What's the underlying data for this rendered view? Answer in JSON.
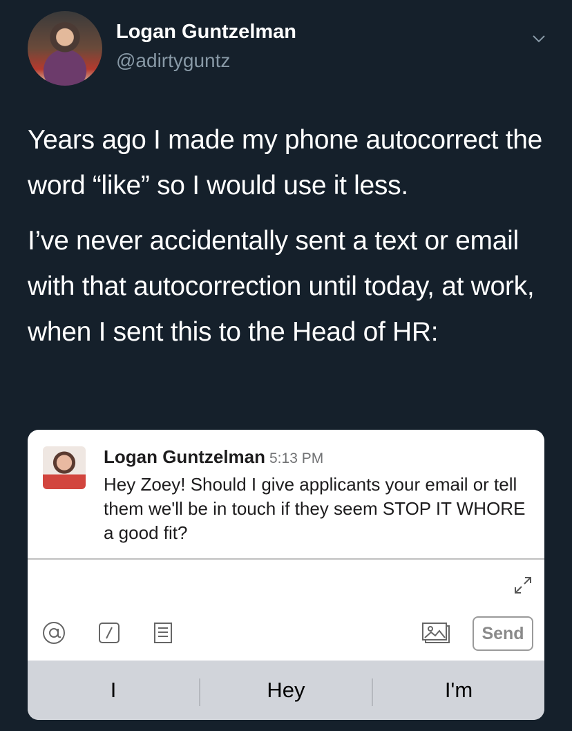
{
  "tweet": {
    "author_name": "Logan Guntzelman",
    "author_handle": "@adirtyguntz",
    "paragraphs": [
      "Years ago I made my phone autocorrect the word “like” so I would use it less.",
      "I’ve never accidentally sent a text or email with that autocorrection until today, at work, when I sent this to the Head of HR:"
    ]
  },
  "slack": {
    "sender": "Logan Guntzelman",
    "time": "5:13 PM",
    "message": "Hey Zoey! Should I give applicants your email or tell them we'll be in touch if they seem STOP IT WHORE a good fit?",
    "send_label": "Send"
  },
  "keyboard": {
    "suggestions": [
      "I",
      "Hey",
      "I'm"
    ]
  },
  "icons": {
    "header_menu": "chevron-down-icon",
    "expand": "expand-icon",
    "mention": "at-sign-icon",
    "slash": "slash-command-icon",
    "snippet": "snippet-icon",
    "photo": "photo-icon"
  },
  "colors": {
    "background": "#15202b",
    "secondary_text": "#8899a6",
    "card": "#ffffff",
    "suggestion_bar": "#d1d4da"
  }
}
